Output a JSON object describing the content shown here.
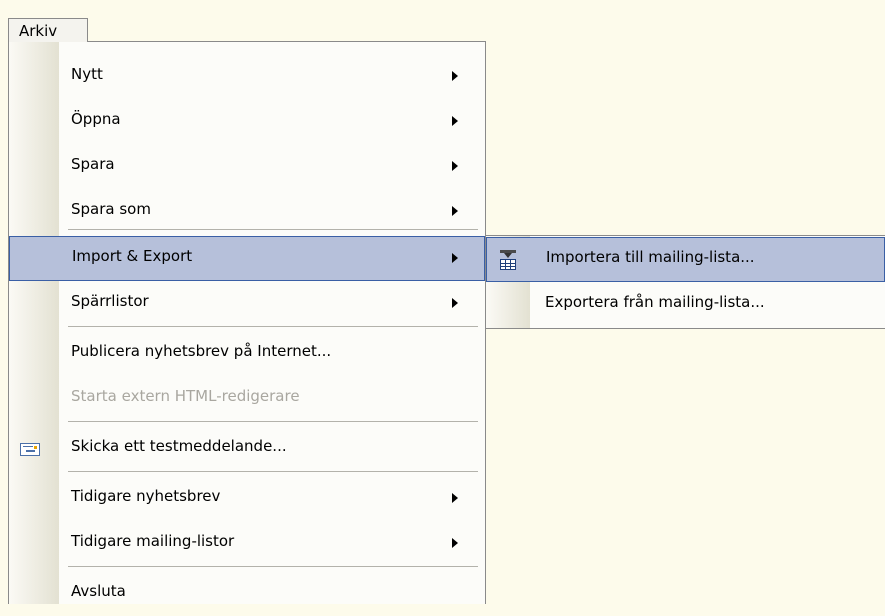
{
  "menubar": {
    "file_label": "Arkiv"
  },
  "menu": {
    "items": [
      {
        "label": "Nytt"
      },
      {
        "label": "Öppna"
      },
      {
        "label": "Spara"
      },
      {
        "label": "Spara som"
      },
      {
        "label": "Import & Export"
      },
      {
        "label": "Spärrlistor"
      },
      {
        "label": "Publicera nyhetsbrev på Internet..."
      },
      {
        "label": "Starta extern HTML-redigerare"
      },
      {
        "label": "Skicka ett testmeddelande..."
      },
      {
        "label": "Tidigare nyhetsbrev"
      },
      {
        "label": "Tidigare mailing-listor"
      },
      {
        "label": "Avsluta"
      }
    ]
  },
  "submenu": {
    "items": [
      {
        "label": "Importera till mailing-lista..."
      },
      {
        "label": "Exportera från mailing-lista..."
      }
    ]
  },
  "colors": {
    "background": "#fdfbeb",
    "highlight": "#b6c0da",
    "highlight_border": "#3a5fa5",
    "disabled_text": "#a9a7a0"
  },
  "icons": [
    "submenu-arrow-icon",
    "mail-icon",
    "import-table-icon"
  ]
}
